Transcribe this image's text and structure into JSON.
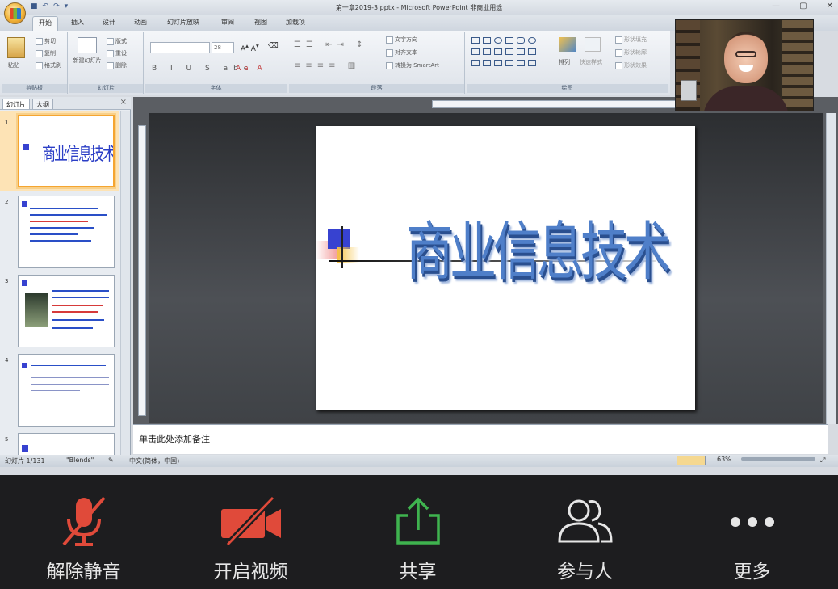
{
  "ppt": {
    "window_title": "第一章2019-3.pptx - Microsoft PowerPoint 非商业用途",
    "tabs": [
      "开始",
      "插入",
      "设计",
      "动画",
      "幻灯片放映",
      "审阅",
      "视图",
      "加载项"
    ],
    "active_tab": "开始",
    "ribbon": {
      "groups": [
        "剪贴板",
        "幻灯片",
        "字体",
        "段落",
        "绘图"
      ],
      "clipboard": {
        "paste": "粘贴",
        "cut": "剪切",
        "copy": "复制",
        "format_painter": "格式刷"
      },
      "slides": {
        "new_slide": "新建幻灯片",
        "layout": "版式",
        "reset": "重设",
        "delete": "删除"
      },
      "font": {
        "size": "28"
      },
      "paragraph": {
        "text_direction": "文字方向",
        "align_text": "对齐文本",
        "smartart": "转换为 SmartArt"
      },
      "drawing": {
        "arrange": "排列",
        "quick_styles": "快速样式",
        "shape_fill": "形状填充",
        "shape_outline": "形状轮廓",
        "shape_effects": "形状效果"
      }
    },
    "panel": {
      "tabs": [
        "幻灯片",
        "大纲"
      ],
      "close": "×",
      "thumbnails": [
        {
          "num": "1",
          "title": "商业信息技术"
        },
        {
          "num": "2"
        },
        {
          "num": "3"
        },
        {
          "num": "4"
        },
        {
          "num": "5"
        }
      ]
    },
    "slide": {
      "title": "商业信息技术"
    },
    "notes_placeholder": "单击此处添加备注",
    "status": {
      "slide_count": "幻灯片 1/131",
      "theme": "\"Blends\"",
      "language": "中文(简体，中国)",
      "zoom": "63%"
    }
  },
  "toolbar": {
    "buttons": [
      {
        "label": "解除静音",
        "icon": "mic-muted-icon",
        "color": "#e04a3a"
      },
      {
        "label": "开启视频",
        "icon": "video-off-icon",
        "color": "#e04a3a"
      },
      {
        "label": "共享",
        "icon": "share-icon",
        "color": "#3fb34f"
      },
      {
        "label": "参与人",
        "icon": "participants-icon",
        "color": "#e6e6e6"
      },
      {
        "label": "更多",
        "icon": "more-icon",
        "color": "#e6e6e6"
      }
    ]
  }
}
